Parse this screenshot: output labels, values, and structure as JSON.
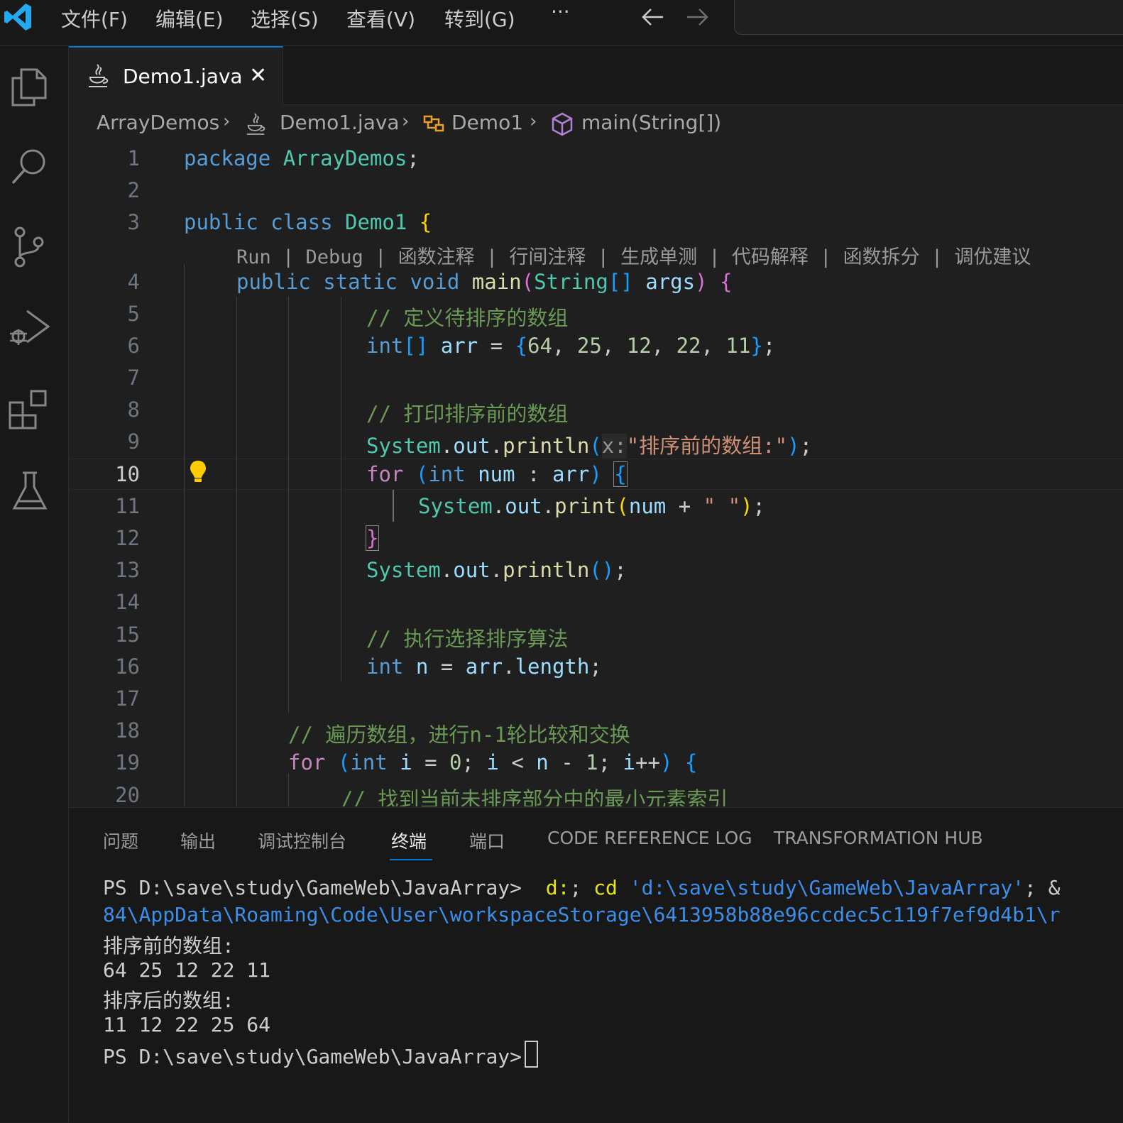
{
  "titlebar": {
    "menus": [
      "文件(F)",
      "编辑(E)",
      "选择(S)",
      "查看(V)",
      "转到(G)",
      "···"
    ]
  },
  "tab": {
    "label": "Demo1.java",
    "close": "✕"
  },
  "breadcrumb": [
    "ArrayDemos",
    "Demo1.java",
    "Demo1",
    "main(String[])"
  ],
  "codelens": "Run | Debug | 函数注释 | 行间注释 | 生成单测 | 代码解释 | 函数拆分 | 调优建议",
  "editor": {
    "current_line": 10,
    "line_numbers": [
      "1",
      "2",
      "3",
      "4",
      "5",
      "6",
      "7",
      "8",
      "9",
      "10",
      "11",
      "12",
      "13",
      "14",
      "15",
      "16",
      "17",
      "18",
      "19",
      "20"
    ],
    "lines": [
      "package ArrayDemos;",
      "",
      "public class Demo1 {",
      "public static void main(String[] args) {",
      "// 定义待排序的数组",
      "int[] arr = {64, 25, 12, 22, 11};",
      "",
      "// 打印排序前的数组",
      "System.out.println(x:\"排序前的数组:\");",
      "for (int num : arr) {",
      "System.out.print(num + \" \");",
      "}",
      "System.out.println();",
      "",
      "// 执行选择排序算法",
      "int n = arr.length;",
      "",
      "// 遍历数组，进行n-1轮比较和交换",
      "for (int i = 0; i < n - 1; i++) {",
      "// 找到当前未排序部分中的最小元素索引"
    ]
  },
  "panel": {
    "tabs": [
      "问题",
      "输出",
      "调试控制台",
      "终端",
      "端口",
      "CODE REFERENCE LOG",
      "TRANSFORMATION HUB"
    ],
    "active_tab": "终端",
    "terminal": {
      "prompt1": "PS D:\\save\\study\\GameWeb\\JavaArray> ",
      "cmd1a": "d:",
      "cmd1b": "; ",
      "cmd1c": "cd",
      "cmd1d": " 'd:\\save\\study\\GameWeb\\JavaArray'",
      "cmd1e": "; &",
      "line2": "84\\AppData\\Roaming\\Code\\User\\workspaceStorage\\6413958b88e96ccdec5c119f7ef9d4b1\\r",
      "line3": "排序前的数组:",
      "line4": "64 25 12 22 11",
      "line5": "排序后的数组:",
      "line6": "11 12 22 25 64",
      "prompt2": "PS D:\\save\\study\\GameWeb\\JavaArray>"
    }
  }
}
